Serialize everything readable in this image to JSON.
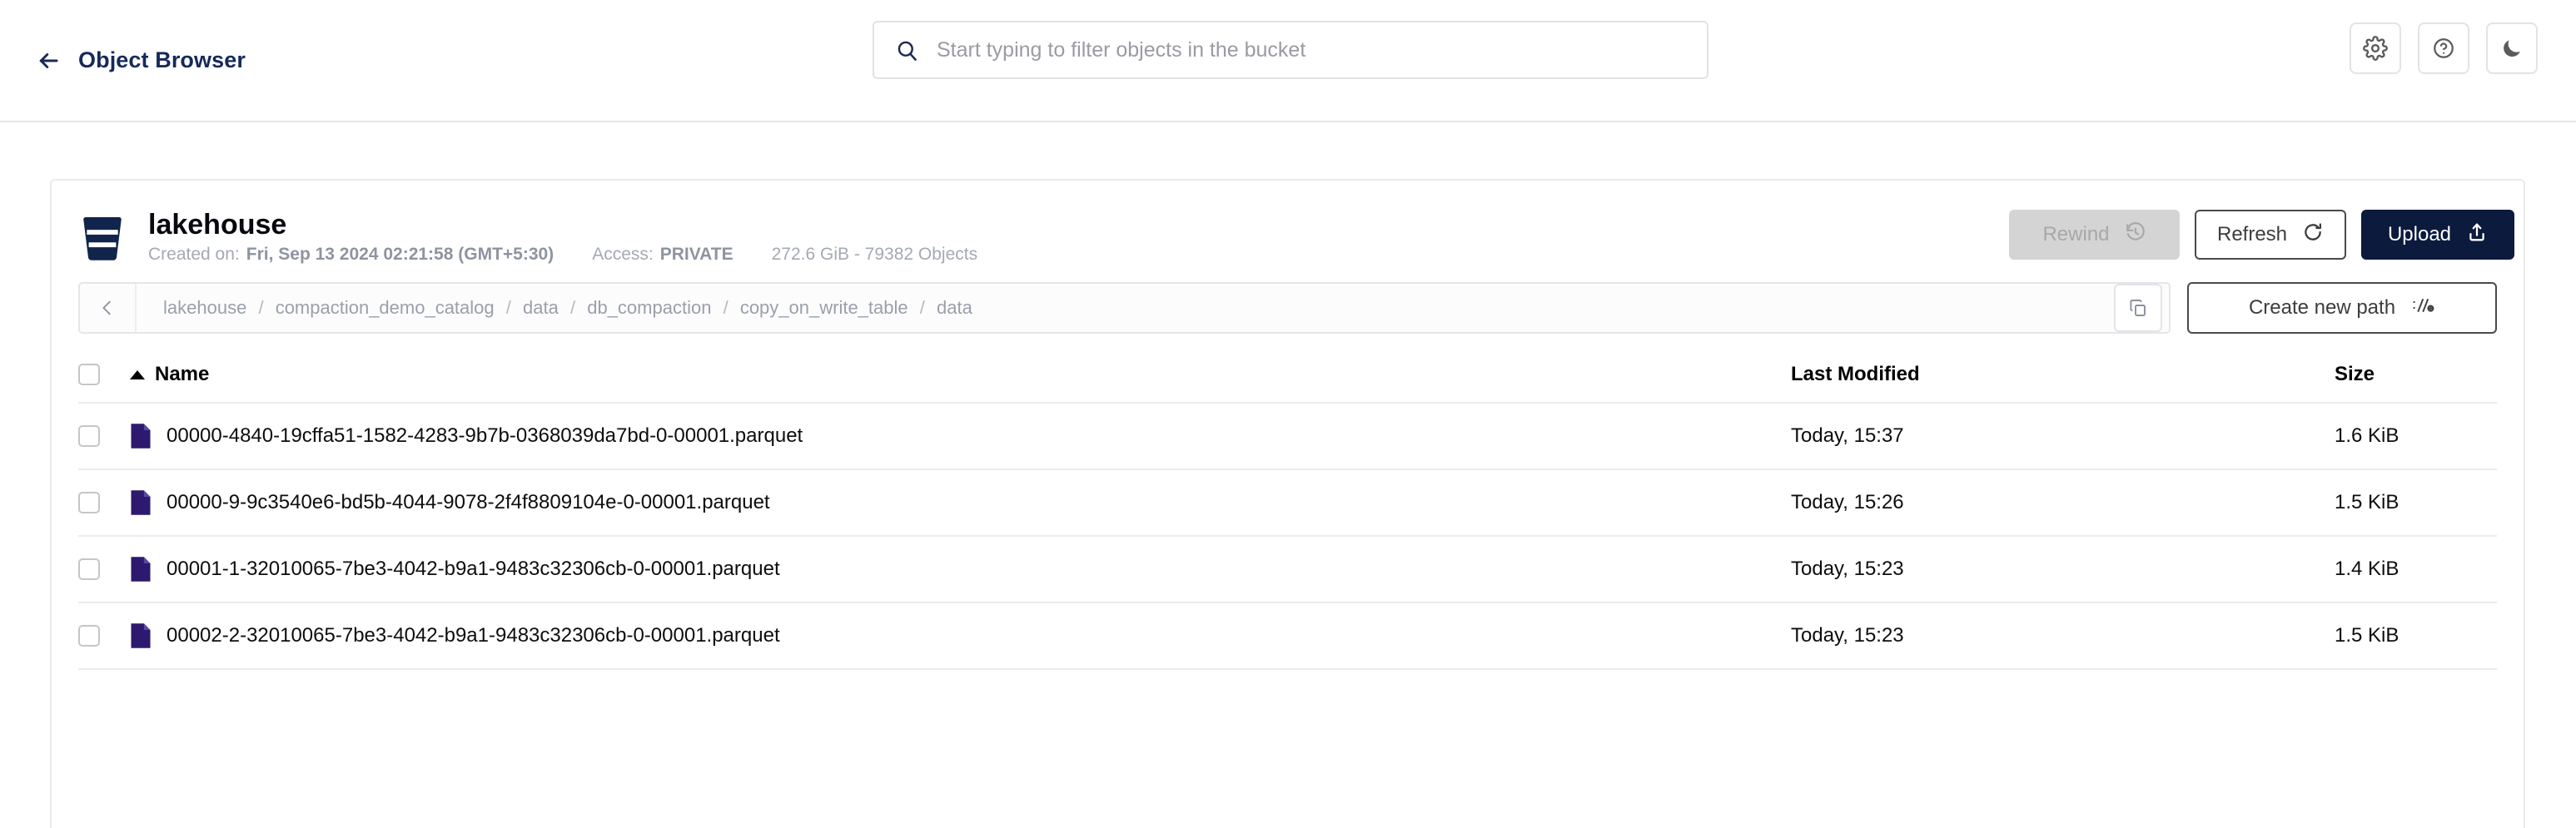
{
  "topbar": {
    "back_icon": "arrow-left-icon",
    "title": "Object Browser",
    "search": {
      "icon": "search-icon",
      "placeholder": "Start typing to filter objects in the bucket",
      "value": ""
    },
    "actions": [
      {
        "name": "settings-button",
        "icon": "gear-icon"
      },
      {
        "name": "help-button",
        "icon": "question-circle-icon"
      },
      {
        "name": "theme-toggle-button",
        "icon": "moon-icon"
      }
    ]
  },
  "bucket": {
    "icon": "bucket-icon",
    "name": "lakehouse",
    "created_label": "Created on:",
    "created_value": "Fri, Sep 13 2024 02:21:58 (GMT+5:30)",
    "access_label": "Access:",
    "access_value": "PRIVATE",
    "stats": "272.6 GiB - 79382 Objects",
    "actions": {
      "rewind": {
        "label": "Rewind",
        "icon": "rewind-clock-icon",
        "disabled": true
      },
      "refresh": {
        "label": "Refresh",
        "icon": "refresh-icon",
        "disabled": false
      },
      "upload": {
        "label": "Upload",
        "icon": "upload-icon",
        "disabled": false
      }
    }
  },
  "breadcrumb": {
    "back_icon": "chevron-left-icon",
    "segments": [
      "lakehouse",
      "compaction_demo_catalog",
      "data",
      "db_compaction",
      "copy_on_write_table",
      "data"
    ],
    "separator": "/",
    "copy_icon": "copy-icon",
    "create_path": {
      "label": "Create new path",
      "icon": "new-path-icon"
    }
  },
  "table": {
    "headers": {
      "name": "Name",
      "last_modified": "Last Modified",
      "size": "Size"
    },
    "sort": {
      "column": "Name",
      "direction": "asc"
    },
    "rows": [
      {
        "name": "00000-4840-19cffa51-1582-4283-9b7b-0368039da7bd-0-00001.parquet",
        "last_modified": "Today, 15:37",
        "size": "1.6 KiB",
        "icon": "parquet-file-icon",
        "selected": false
      },
      {
        "name": "00000-9-9c3540e6-bd5b-4044-9078-2f4f8809104e-0-00001.parquet",
        "last_modified": "Today, 15:26",
        "size": "1.5 KiB",
        "icon": "parquet-file-icon",
        "selected": false
      },
      {
        "name": "00001-1-32010065-7be3-4042-b9a1-9483c32306cb-0-00001.parquet",
        "last_modified": "Today, 15:23",
        "size": "1.4 KiB",
        "icon": "parquet-file-icon",
        "selected": false
      },
      {
        "name": "00002-2-32010065-7be3-4042-b9a1-9483c32306cb-0-00001.parquet",
        "last_modified": "Today, 15:23",
        "size": "1.5 KiB",
        "icon": "parquet-file-icon",
        "selected": false
      }
    ]
  },
  "colors": {
    "brand_navy": "#0b1a3d",
    "title_navy": "#16295a",
    "file_icon": "#2d1a6e",
    "muted_text": "#9aa0ab",
    "divider": "#ececec"
  }
}
